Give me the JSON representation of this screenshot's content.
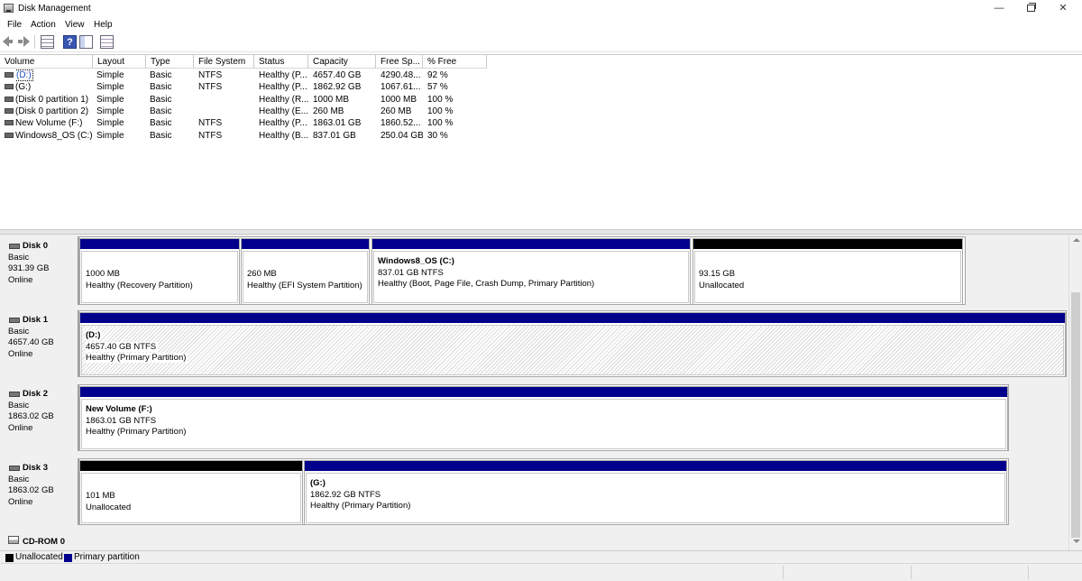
{
  "window": {
    "title": "Disk Management",
    "minimize_glyph": "—",
    "close_glyph": "✕"
  },
  "menu": [
    "File",
    "Action",
    "View",
    "Help"
  ],
  "toolbar": {
    "icons": [
      "back-arrow-icon",
      "forward-arrow-icon",
      "console-tree-icon",
      "help-icon",
      "properties-icon",
      "show-hide-icon"
    ],
    "help_glyph": "?"
  },
  "volume_list": {
    "columns": [
      "Volume",
      "Layout",
      "Type",
      "File System",
      "Status",
      "Capacity",
      "Free Sp...",
      "% Free"
    ],
    "rows": [
      [
        "(D:)",
        "Simple",
        "Basic",
        "NTFS",
        "Healthy (P...",
        "4657.40 GB",
        "4290.48...",
        "92 %"
      ],
      [
        "(G:)",
        "Simple",
        "Basic",
        "NTFS",
        "Healthy (P...",
        "1862.92 GB",
        "1067.61...",
        "57 %"
      ],
      [
        "(Disk 0 partition 1)",
        "Simple",
        "Basic",
        "",
        "Healthy (R...",
        "1000 MB",
        "1000 MB",
        "100 %"
      ],
      [
        "(Disk 0 partition 2)",
        "Simple",
        "Basic",
        "",
        "Healthy (E...",
        "260 MB",
        "260 MB",
        "100 %"
      ],
      [
        "New Volume (F:)",
        "Simple",
        "Basic",
        "NTFS",
        "Healthy (P...",
        "1863.01 GB",
        "1860.52...",
        "100 %"
      ],
      [
        "Windows8_OS (C:)",
        "Simple",
        "Basic",
        "NTFS",
        "Healthy (B...",
        "837.01 GB",
        "250.04 GB",
        "30 %"
      ]
    ],
    "selected_row": 0
  },
  "disks": [
    {
      "name": "Disk 0",
      "type": "Basic",
      "size": "931.39 GB",
      "state": "Online",
      "partitions": [
        {
          "label": "",
          "size": "1000 MB",
          "status": "Healthy (Recovery Partition)",
          "kind": "primary"
        },
        {
          "label": "",
          "size": "260 MB",
          "status": "Healthy (EFI System Partition)",
          "kind": "primary"
        },
        {
          "label": "Windows8_OS  (C:)",
          "size": "837.01 GB NTFS",
          "status": "Healthy (Boot, Page File, Crash Dump, Primary Partition)",
          "kind": "primary"
        },
        {
          "label": "",
          "size": "93.15 GB",
          "status": "Unallocated",
          "kind": "unallocated"
        }
      ]
    },
    {
      "name": "Disk 1",
      "type": "Basic",
      "size": "4657.40 GB",
      "state": "Online",
      "partitions": [
        {
          "label": "(D:)",
          "size": "4657.40 GB NTFS",
          "status": "Healthy (Primary Partition)",
          "kind": "primary"
        }
      ]
    },
    {
      "name": "Disk 2",
      "type": "Basic",
      "size": "1863.02 GB",
      "state": "Online",
      "partitions": [
        {
          "label": "New Volume  (F:)",
          "size": "1863.01 GB NTFS",
          "status": "Healthy (Primary Partition)",
          "kind": "primary"
        }
      ]
    },
    {
      "name": "Disk 3",
      "type": "Basic",
      "size": "1863.02 GB",
      "state": "Online",
      "partitions": [
        {
          "label": "",
          "size": "101 MB",
          "status": "Unallocated",
          "kind": "unallocated"
        },
        {
          "label": "(G:)",
          "size": "1862.92 GB NTFS",
          "status": "Healthy (Primary Partition)",
          "kind": "primary"
        }
      ]
    }
  ],
  "cdrom": {
    "name": "CD-ROM 0"
  },
  "legend": [
    {
      "label": "Unallocated",
      "color": "#000000"
    },
    {
      "label": "Primary partition",
      "color": "#00008c"
    }
  ],
  "colors": {
    "primary": "#00008c",
    "unallocated": "#000000"
  }
}
